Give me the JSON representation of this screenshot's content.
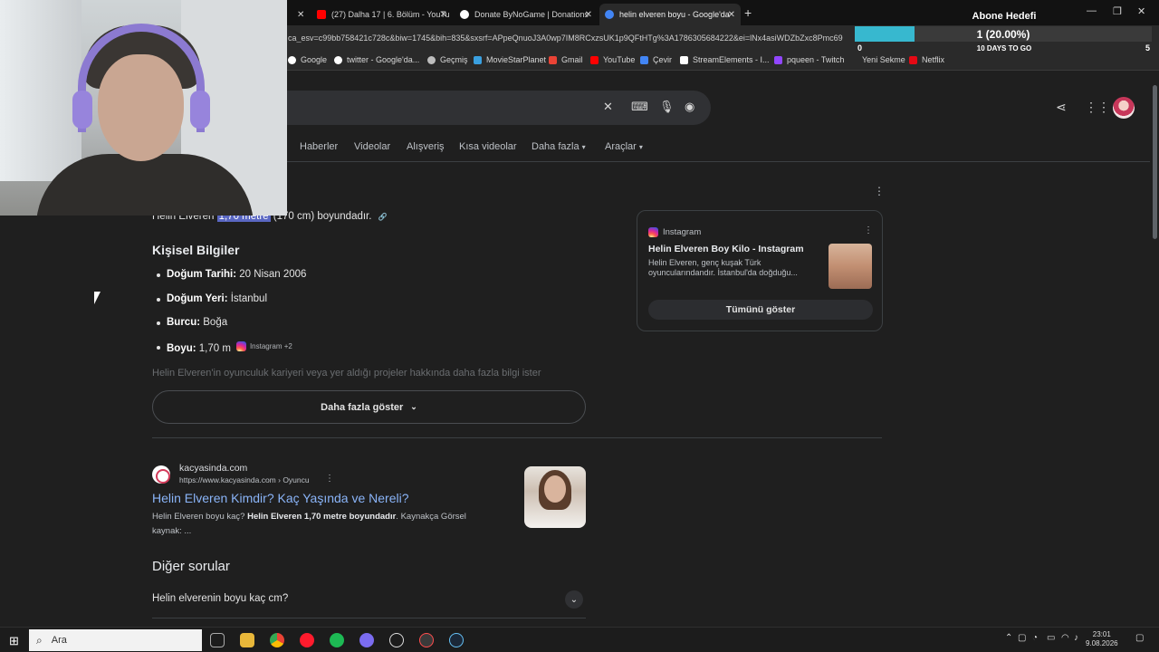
{
  "tabs": [
    {
      "title": "(27) Dalha 17 | 6. Bölüm - YouTu",
      "color": "#ff0000"
    },
    {
      "title": "Donate ByNoGame | Donations",
      "color": "#ffffff"
    },
    {
      "title": "helin elveren boyu - Google'da",
      "color": "#4285f4"
    }
  ],
  "url": "ca_esv=c99bb758421c728c&biw=1745&bih=835&sxsrf=APpeQnuoJ3A0wp7IM8RCxzsUK1p9QFtHTg%3A1786305684222&ei=lNx4asiWDZbZxc8Pmc69",
  "bookmarks": [
    {
      "label": "Google",
      "color": "#ffffff"
    },
    {
      "label": "twitter - Google'da...",
      "color": "#ffffff"
    },
    {
      "label": "Geçmiş",
      "color": "#bdbdbd"
    },
    {
      "label": "MovieStarPlanet",
      "color": "#3aa0e0"
    },
    {
      "label": "Gmail",
      "color": "#ea4335"
    },
    {
      "label": "YouTube",
      "color": "#ff0000"
    },
    {
      "label": "Çevir",
      "color": "#4285f4"
    },
    {
      "label": "StreamElements - I...",
      "color": "#ffffff"
    },
    {
      "label": "pqueen - Twitch",
      "color": "#9146ff"
    },
    {
      "label": "Yeni Sekme",
      "color": "#2a2a2a"
    },
    {
      "label": "Netflix",
      "color": "#e50914"
    }
  ],
  "overlay": {
    "title": "Abone Hedefi",
    "progress_text": "1 (20.00%)",
    "progress_fraction": 0.2,
    "min": "0",
    "max": "5",
    "days": "10 DAYS TO GO"
  },
  "nav": {
    "items": [
      "Haberler",
      "Videolar",
      "Alışveriş",
      "Kısa videolar",
      "Daha fazla",
      "Araçlar"
    ]
  },
  "snippet": {
    "top_line_prefix": "Helin Elveren ",
    "top_line_highlight": "1,70 metre",
    "top_line_suffix": " (170 cm) boyundadır.",
    "section_title": "Kişisel Bilgiler",
    "facts": [
      {
        "label": "Doğum Tarihi:",
        "value": " 20 Nisan 2006"
      },
      {
        "label": "Doğum Yeri:",
        "value": " İstanbul"
      },
      {
        "label": "Burcu:",
        "value": " Boğa"
      },
      {
        "label": "Boyu:",
        "value": " 1,70 m"
      }
    ],
    "source_chip": "Instagram +2",
    "faded_line": "Helin Elveren'in oyunculuk kariyeri veya yer aldığı projeler hakkında daha fazla bilgi ister",
    "more_button": "Daha fazla göster"
  },
  "instagram_card": {
    "source": "Instagram",
    "title": "Helin Elveren Boy Kilo - Instagram",
    "desc_line1": "Helin Elveren, genç kuşak Türk",
    "desc_line2": "oyuncularındandır. İstanbul'da doğduğu...",
    "button": "Tümünü göster"
  },
  "result": {
    "site": "kacyasinda.com",
    "breadcrumb": "https://www.kacyasinda.com › Oyuncu",
    "title": "Helin Elveren Kimdir? Kaç Yaşında ve Nereli?",
    "snippet_a": "Helin Elveren boyu kaç? ",
    "snippet_b": "Helin Elveren 1,70 metre boyundadır",
    "snippet_c": ". Kaynakça Görsel",
    "snippet_line2": "kaynak: ..."
  },
  "faq": {
    "title": "Diğer sorular",
    "q1": "Helin elverenin boyu kaç cm?"
  },
  "taskbar": {
    "search": "Ara",
    "time": "23:01",
    "date": "9.08.2026"
  }
}
